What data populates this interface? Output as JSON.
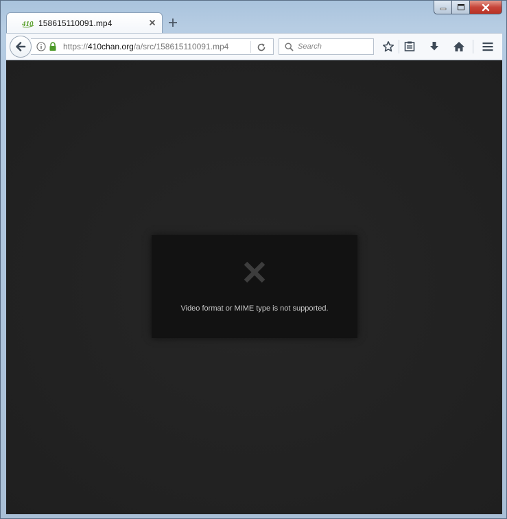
{
  "window": {
    "caption": {
      "minimize": "minimize",
      "maximize": "maximize",
      "close": "close"
    }
  },
  "tab": {
    "title": "158615110091.mp4",
    "favicon_text": "410",
    "favicon_color": "#5aa02c"
  },
  "navbar": {
    "url_prefix": "https://",
    "url_domain": "410chan.org",
    "url_path": "/a/src/158615110091.mp4",
    "search_placeholder": "Search"
  },
  "icons": {
    "back": "back-arrow-icon",
    "info": "info-icon",
    "lock": "lock-icon",
    "reload": "reload-icon",
    "search": "search-icon",
    "bookmark": "star-icon",
    "reader": "reading-list-icon",
    "downloads": "download-icon",
    "home": "home-icon",
    "menu": "hamburger-menu-icon"
  },
  "colors": {
    "lock_green": "#4d9a2a",
    "content_bg": "#222222",
    "error_box_bg": "#121212"
  },
  "video_error": {
    "message": "Video format or MIME type is not supported."
  }
}
